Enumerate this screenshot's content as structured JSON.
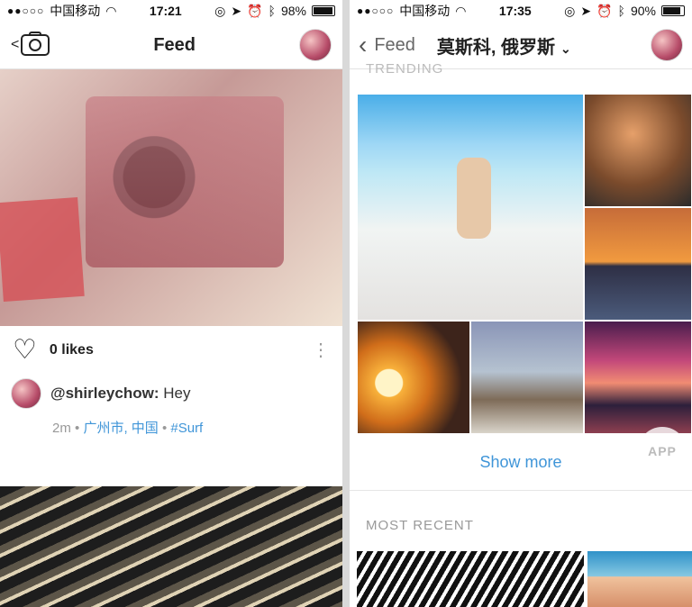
{
  "left": {
    "status": {
      "signal": "●●○○○",
      "carrier": "中国移动",
      "time": "17:21",
      "battery": "98%",
      "battery_level": 0.98
    },
    "nav": {
      "title": "Feed",
      "camera_label": "<"
    },
    "post": {
      "likes": "0 likes",
      "comment_user": "@shirleychow:",
      "comment_text": " Hey",
      "meta_time": "2m",
      "meta_sep1": " • ",
      "meta_location": "广州市, 中国",
      "meta_sep2": " • ",
      "meta_tag": "#Surf"
    }
  },
  "right": {
    "status": {
      "signal": "●●○○○",
      "carrier": "中国移动",
      "time": "17:35",
      "battery": "90%",
      "battery_level": 0.9
    },
    "nav": {
      "back_label": "Feed",
      "title": "莫斯科, 俄罗斯"
    },
    "sections": {
      "trending": "TRENDING",
      "show_more": "Show more",
      "most_recent": "MOST RECENT"
    },
    "watermark": "APP"
  }
}
